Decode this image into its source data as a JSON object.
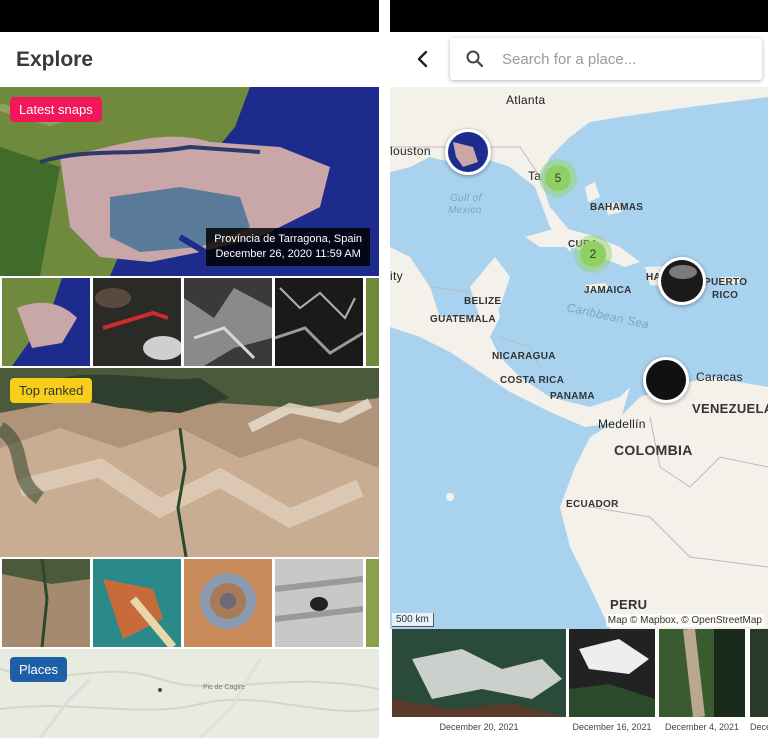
{
  "explore": {
    "title": "Explore",
    "sections": {
      "latest": {
        "label": "Latest snaps",
        "color": "#f2175a"
      },
      "top": {
        "label": "Top ranked",
        "color": "#f7cf1b"
      },
      "places": {
        "label": "Places",
        "color": "#1f5fa8"
      }
    },
    "hero_caption": {
      "place": "Província de Tarragona, Spain",
      "date": "December 26, 2020 11:59 AM"
    },
    "places_map": {
      "label": "Pic de Cagire"
    }
  },
  "map_view": {
    "search_placeholder": "Search for a place...",
    "labels": {
      "atlanta": "Atlanta",
      "houston": "louston",
      "tampa": "Ta",
      "gulf1": "Gulf of",
      "gulf2": "Mexico",
      "bahamas": "BAHAMAS",
      "cuba": "CUBA",
      "jamaica": "JAMAICA",
      "haiti": "HA",
      "puerto": "PUERTO",
      "rico": "RICO",
      "belize": "BELIZE",
      "guatemala": "GUATEMALA",
      "city": "ity",
      "nicaragua": "NICARAGUA",
      "costa_rica": "COSTA RICA",
      "panama": "PANAMA",
      "caribbean": "Caribbean Sea",
      "caracas": "Caracas",
      "venezuela": "VENEZUELA",
      "medellin": "Medellín",
      "colombia": "COLOMBIA",
      "ecuador": "ECUADOR",
      "peru": "PERU"
    },
    "clusters": [
      {
        "count": "5"
      },
      {
        "count": "2"
      }
    ],
    "scale": "500 km",
    "attribution": "Map © Mapbox, © OpenStreetMap",
    "strip": [
      {
        "date": "December 20, 2021"
      },
      {
        "date": "December 16, 2021"
      },
      {
        "date": "December 4, 2021"
      },
      {
        "date": "Dece"
      }
    ]
  },
  "colors": {
    "water": "#a9d2ef",
    "land": "#f4f1ea",
    "cluster": "#90d060"
  }
}
